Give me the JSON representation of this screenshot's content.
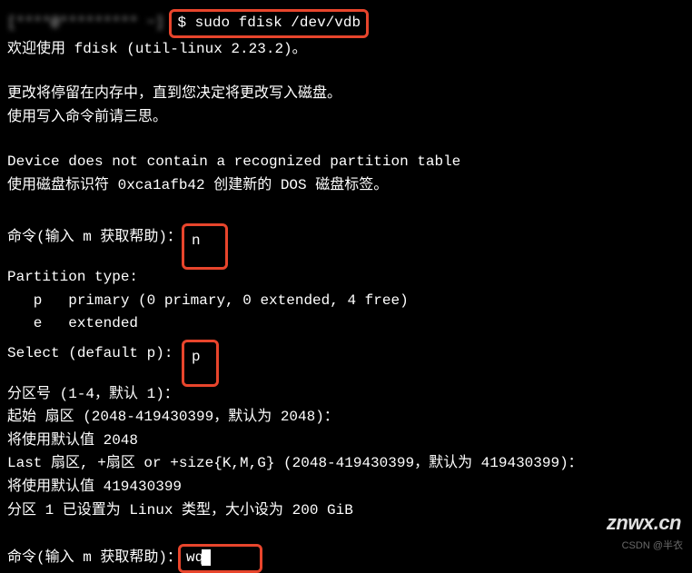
{
  "terminal": {
    "prompt_masked": "[****@********* ~]",
    "prompt_symbol": "$",
    "command": "sudo fdisk /dev/vdb",
    "lines": {
      "welcome": "欢迎使用 fdisk (util-linux 2.23.2)。",
      "memory_notice": "更改将停留在内存中，直到您决定将更改写入磁盘。",
      "write_warning": "使用写入命令前请三思。",
      "no_partition": "Device does not contain a recognized partition table",
      "disk_label": "使用磁盘标识符 0xca1afb42 创建新的 DOS 磁盘标签。",
      "cmd_prompt_prefix": "命令(输入 m 获取帮助)：",
      "input_n": "n",
      "partition_type": "Partition type:",
      "option_p": "   p   primary (0 primary, 0 extended, 4 free)",
      "option_e": "   e   extended",
      "select_default_prefix": "Select (default p):",
      "input_p": "p",
      "partition_num": "分区号 (1-4，默认 1)：",
      "first_sector": "起始 扇区 (2048-419430399，默认为 2048)：",
      "default_2048": "将使用默认值 2048",
      "last_sector": "Last 扇区, +扇区 or +size{K,M,G} (2048-419430399，默认为 419430399)：",
      "default_last": "将使用默认值 419430399",
      "partition_set": "分区 1 已设置为 Linux 类型，大小设为 200 GiB",
      "input_wq": "wq"
    }
  },
  "watermark": {
    "main": "znwx.cn",
    "sub": "CSDN @半衣"
  }
}
